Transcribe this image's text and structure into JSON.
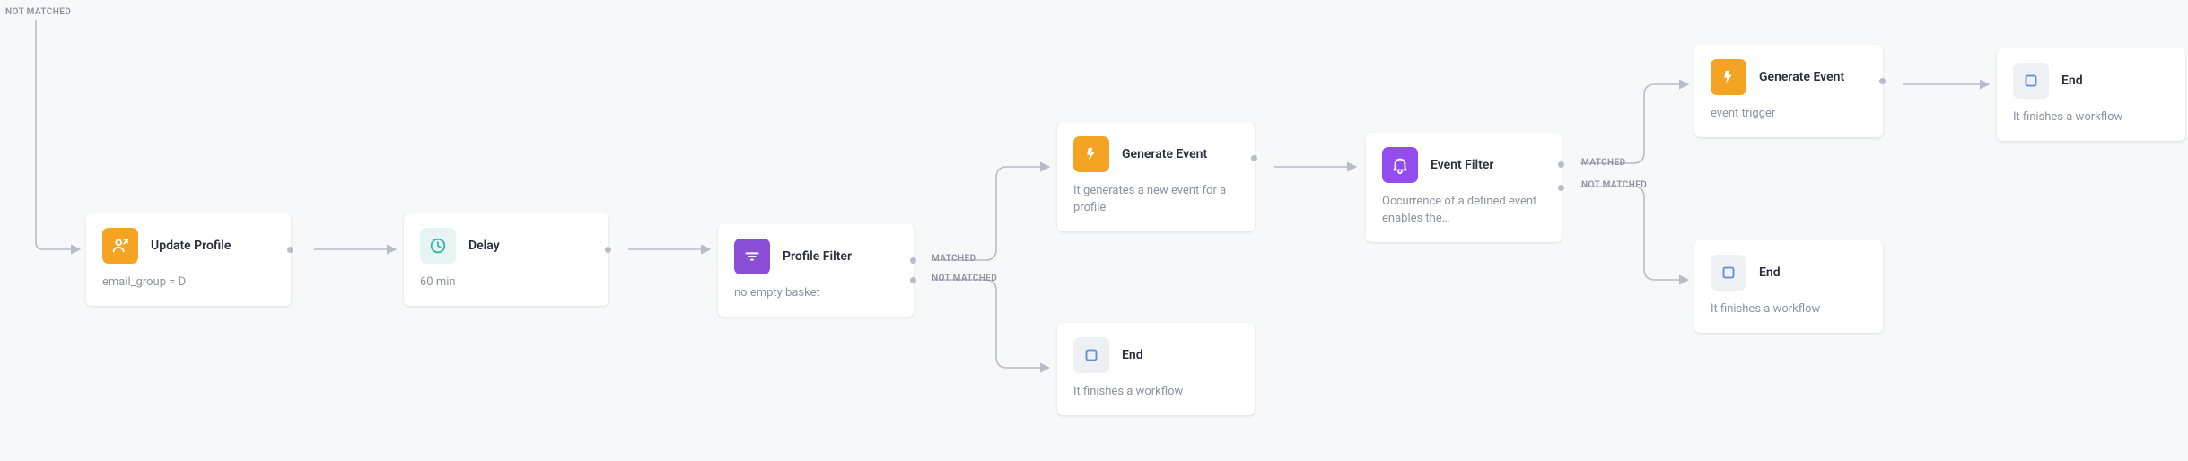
{
  "nodes": {
    "update_profile": {
      "title": "Update Profile",
      "subtitle": "email_group = D"
    },
    "delay": {
      "title": "Delay",
      "subtitle": "60 min"
    },
    "profile_filter": {
      "title": "Profile Filter",
      "subtitle": "no empty basket"
    },
    "generate_event_1": {
      "title": "Generate Event",
      "subtitle": "It generates a new event for a profile"
    },
    "end_1": {
      "title": "End",
      "subtitle": "It finishes a workflow"
    },
    "event_filter": {
      "title": "Event Filter",
      "subtitle": "Occurrence of a defined event enables the…"
    },
    "generate_event_2": {
      "title": "Generate Event",
      "subtitle": "event trigger"
    },
    "end_2": {
      "title": "End",
      "subtitle": "It finishes a workflow"
    },
    "end_3": {
      "title": "End",
      "subtitle": "It finishes a workflow"
    }
  },
  "labels": {
    "not_matched_top": "NOT MATCHED",
    "pf_matched": "MATCHED",
    "pf_not_matched": "NOT MATCHED",
    "ef_matched": "MATCHED",
    "ef_not_matched": "NOT MATCHED"
  }
}
